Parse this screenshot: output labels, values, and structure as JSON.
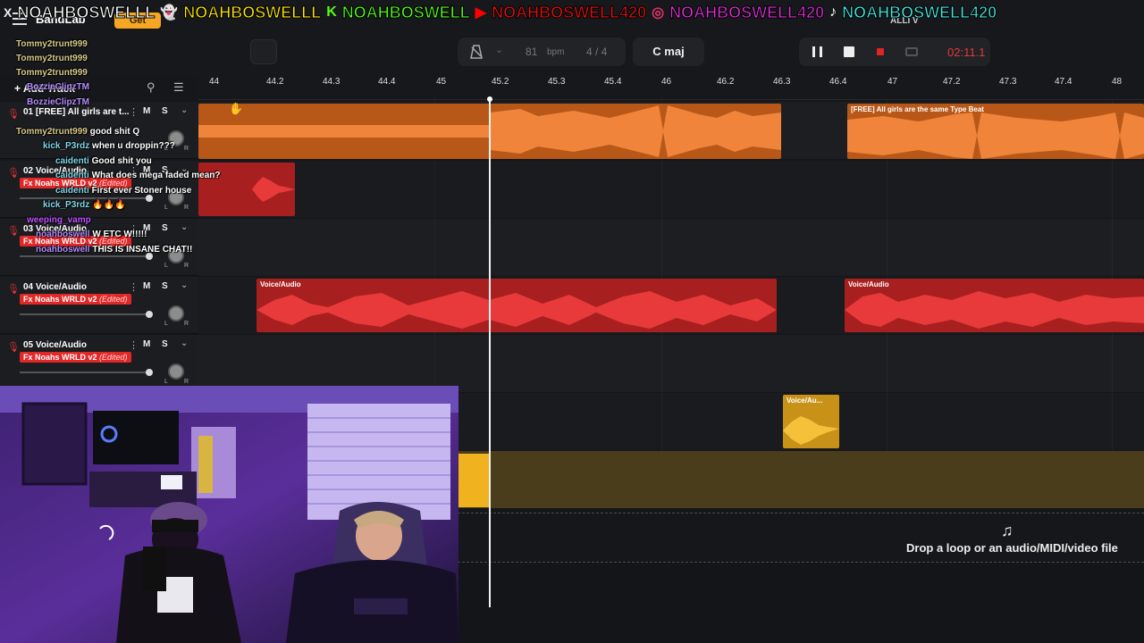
{
  "banner": {
    "x_handle": "NOAHBOSWELLL",
    "snapchat_handle": "NOAHBOSWELLL",
    "kick_handle": "NOAHBOSWELL",
    "youtube_handle": "NOAHBOSWELL420",
    "instagram_handle": "NOAHBOSWELL420",
    "tiktok_handle": "NOAHBOSWELL420",
    "x_glyph": "X",
    "kick_glyph": "K"
  },
  "toolbar": {
    "app_name": "BandLab",
    "get_label": "Get",
    "bpm_value": "81",
    "bpm_label": "bpm",
    "time_signature": "4 / 4",
    "key": "C maj",
    "time_display": "02:11.1",
    "user": "ALLI V",
    "add_track_label": "Add Track"
  },
  "ruler": {
    "ticks": [
      "44",
      "44.2",
      "44.3",
      "44.4",
      "45",
      "45.2",
      "45.3",
      "45.4",
      "46",
      "46.2",
      "46.3",
      "46.4",
      "47",
      "47.2",
      "47.3",
      "47.4",
      "48"
    ]
  },
  "tracks": [
    {
      "name": "01  [FREE] All girls are t...",
      "fx": "",
      "fx_edited": ""
    },
    {
      "name": "02  Voice/Audio",
      "fx": "Fx Noahs WRLD v2",
      "fx_edited": "(Edited)"
    },
    {
      "name": "03  Voice/Audio",
      "fx": "Fx Noahs WRLD v2",
      "fx_edited": "(Edited)"
    },
    {
      "name": "04  Voice/Audio",
      "fx": "Fx Noahs WRLD v2",
      "fx_edited": "(Edited)"
    },
    {
      "name": "05  Voice/Audio",
      "fx": "Fx Noahs WRLD v2",
      "fx_edited": "(Edited)"
    }
  ],
  "track_buttons": {
    "mute": "M",
    "solo": "S",
    "pan_left": "L",
    "pan_right": "R"
  },
  "clips": {
    "beat_title": "[FREE] All girls are the same Type Beat",
    "voice_title": "Voice/Audio",
    "voice_short_title": "Voice/Au..."
  },
  "drop_zone": {
    "text": "Drop a loop or an audio/MIDI/video file"
  },
  "chat": [
    {
      "user": "Tommy2trunt999",
      "msg": ""
    },
    {
      "user": "Tommy2trunt999",
      "msg": ""
    },
    {
      "user": "Tommy2trunt999",
      "msg": ""
    },
    {
      "user": "BozzieClipzTM",
      "msg": ""
    },
    {
      "user": "BozzieClipzTM",
      "msg": ""
    },
    {
      "user": "Tommy2trunt999",
      "msg": "good shit Q"
    },
    {
      "user": "kick_P3rdz",
      "msg": "when u droppin???"
    },
    {
      "user": "caidenti",
      "msg": "Good shit you"
    },
    {
      "user": "caidenti",
      "msg": "What does mega faded mean?"
    },
    {
      "user": "caidenti",
      "msg": "First ever Stoner house"
    },
    {
      "user": "kick_P3rdz",
      "msg": "🔥🔥🔥"
    },
    {
      "user": "weeping_vamp",
      "msg": ""
    },
    {
      "user": "noahboswell",
      "msg": "W ETC W!!!!!"
    },
    {
      "user": "noahboswell",
      "msg": "THIS IS INSANE CHAT!!"
    }
  ],
  "colors": {
    "beat_clip": "#e8731f",
    "voice_clip": "#e12828",
    "yellow_clip": "#f0b21f",
    "time_display": "#e03a3a"
  }
}
